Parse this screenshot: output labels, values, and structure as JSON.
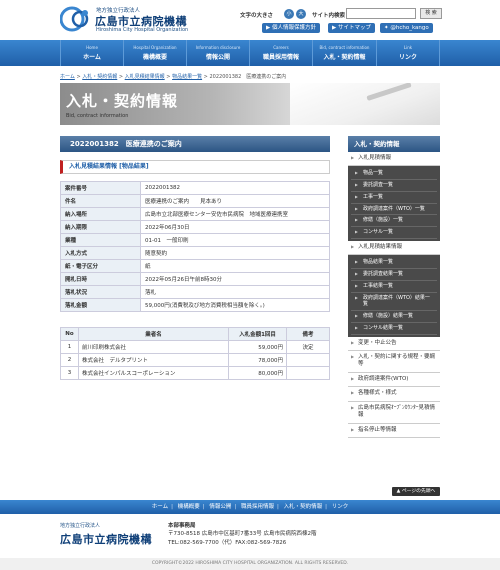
{
  "header": {
    "logo_sub": "地方独立行政法人",
    "logo_name": "広島市立病院機構",
    "logo_en": "Hiroshima City Hospital Organization",
    "font_size_label": "文字の大きさ",
    "font_small": "小",
    "font_large": "大",
    "site_search_label": "サイト内検索",
    "search_button": "検 索",
    "privacy_link": "個人情報保護方針",
    "sitemap_link": "サイトマップ",
    "twitter_link": "@hcho_kango"
  },
  "global_nav": [
    {
      "en": "Home",
      "ja": "ホーム"
    },
    {
      "en": "Hospital Organization",
      "ja": "機構概要"
    },
    {
      "en": "Information disclosure",
      "ja": "情報公開"
    },
    {
      "en": "Careers",
      "ja": "職員採用情報"
    },
    {
      "en": "Bid, contract information",
      "ja": "入札・契約情報"
    },
    {
      "en": "Link",
      "ja": "リンク"
    }
  ],
  "breadcrumb": {
    "items": [
      "ホーム",
      "入札・契約情報",
      "入札見積結果情報",
      "物品結果一覧"
    ],
    "current": "2022001382　医療連携のご案内",
    "separator": ">"
  },
  "hero": {
    "title": "入札・契約情報",
    "en": "Bid, contract information"
  },
  "page_title": "2022001382　医療連携のご案内",
  "section_heading": "入札見積結果情報 [物品結果]",
  "details": [
    {
      "label": "案件番号",
      "value": "2022001382"
    },
    {
      "label": "件名",
      "value": "医療連携のご案内　　見本あり"
    },
    {
      "label": "納入場所",
      "value": "広島市立北部医療センター安佐市民病院　地域医療連携室"
    },
    {
      "label": "納入期限",
      "value": "2022年06月30日"
    },
    {
      "label": "業種",
      "value": "01-01　一般印刷"
    },
    {
      "label": "入札方式",
      "value": "随意契約"
    },
    {
      "label": "紙・電子区分",
      "value": "紙"
    },
    {
      "label": "開札日時",
      "value": "2022年05月26日午前8時30分"
    },
    {
      "label": "落札状況",
      "value": "落札"
    },
    {
      "label": "落札金額",
      "value": "59,000円(消費税及び地方消費税相当額を除く。)"
    }
  ],
  "bidders": {
    "headers": [
      "No",
      "業者名",
      "入札金額1回目",
      "備考"
    ],
    "rows": [
      {
        "no": "1",
        "name": "前川印刷株式会社",
        "amount": "59,000円",
        "note": "決定"
      },
      {
        "no": "2",
        "name": "株式会社　デルタプリント",
        "amount": "78,000円",
        "note": ""
      },
      {
        "no": "3",
        "name": "株式会社インパルスコーポレーション",
        "amount": "80,000円",
        "note": ""
      }
    ]
  },
  "sidebar": {
    "title": "入札・契約情報",
    "group1_title": "入札見積情報",
    "group1_items": [
      "物品一覧",
      "委託調査一覧",
      "工事一覧",
      "政府調達案件（WTO）一覧",
      "修繕（施設）一覧",
      "コンサル一覧"
    ],
    "group2_title": "入札見積結果情報",
    "group2_items": [
      "物品結果一覧",
      "委託調査結果一覧",
      "工事結果一覧",
      "政府調達案件（WTO）結果一覧",
      "修繕（施設）結果一覧",
      "コンサル結果一覧"
    ],
    "other_items": [
      "変更・中止公告",
      "入札・契約に関する規程・要綱等",
      "政府調達案件(WTO)",
      "各種様式・様式",
      "広島市民病院ｵｰﾌﾟﾝｶｳﾝﾀｰ見積情報",
      "指名停止等情報"
    ]
  },
  "page_top": "▲ ページの先頭へ",
  "footer": {
    "nav": [
      "ホーム",
      "機構概要",
      "情報公開",
      "職員採用情報",
      "入札・契約情報",
      "リンク"
    ],
    "logo_sub": "地方独立行政法人",
    "logo_name": "広島市立病院機構",
    "office": "本部事務局",
    "address": "〒730-8518 広島市中区基町7番33号 広島市民病院西棟2階",
    "phone": "TEL:082-569-7700（代）FAX:082-569-7826",
    "copyright": "COPYRIGHT©2022 HIROSHIMA CITY HOSPITAL ORGANIZATION. ALL RIGHTS RESERVED."
  },
  "colors": {
    "brand_blue": "#1f5fa8",
    "title_bar": "#2c5584",
    "accent_red": "#c02020"
  }
}
